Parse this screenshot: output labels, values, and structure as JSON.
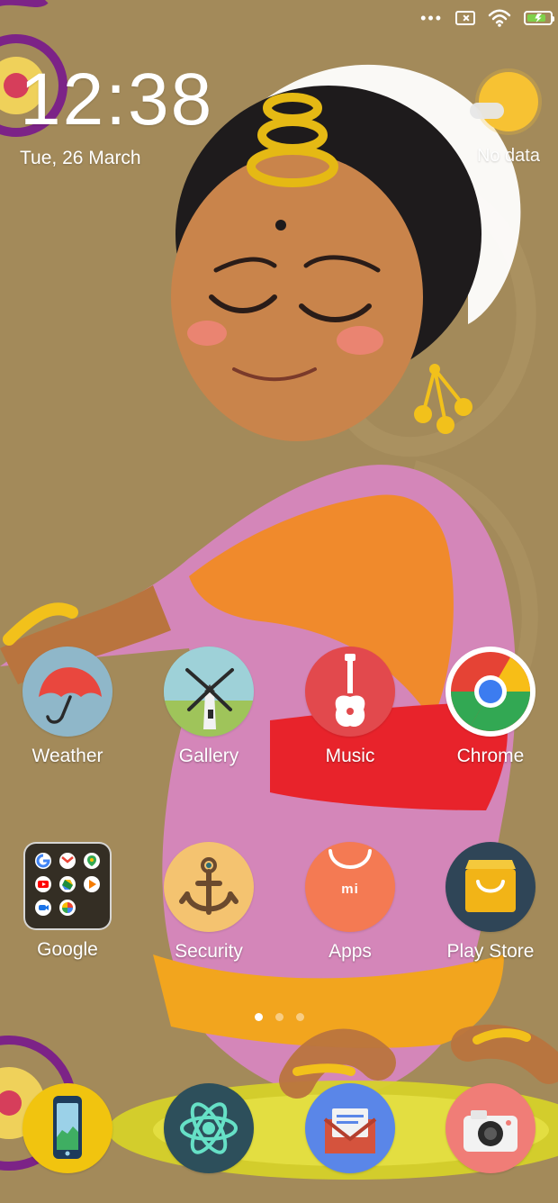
{
  "status": {
    "more": "•••",
    "battery_level": 0.82
  },
  "clock": {
    "time": "12:38",
    "date": "Tue, 26 March"
  },
  "weather": {
    "text": "No data"
  },
  "apps": [
    {
      "label": "Weather",
      "icon": "umbrella-icon",
      "color": "#8FB7C9"
    },
    {
      "label": "Gallery",
      "icon": "windmill-icon",
      "color": "#7DB7B0"
    },
    {
      "label": "Music",
      "icon": "guitar-icon",
      "color": "#E2494D"
    },
    {
      "label": "Chrome",
      "icon": "chrome-icon",
      "color": "#FFFFFF"
    },
    {
      "label": "Google",
      "icon": "folder-icon",
      "color": "#2D2A24"
    },
    {
      "label": "Security",
      "icon": "anchor-icon",
      "color": "#F4C370"
    },
    {
      "label": "Apps",
      "icon": "mi-bag-icon",
      "color": "#F47A53"
    },
    {
      "label": "Play Store",
      "icon": "shopping-bag-icon",
      "color": "#2F4557"
    }
  ],
  "apps_mi_text": "mi",
  "dock": [
    {
      "icon": "phone-icon",
      "color": "#F1C40F"
    },
    {
      "icon": "atom-icon",
      "color": "#2D4F5B"
    },
    {
      "icon": "mail-icon",
      "color": "#5A86E8"
    },
    {
      "icon": "camera-icon",
      "color": "#F07D77"
    }
  ],
  "pages": {
    "current": 1,
    "count": 3
  }
}
